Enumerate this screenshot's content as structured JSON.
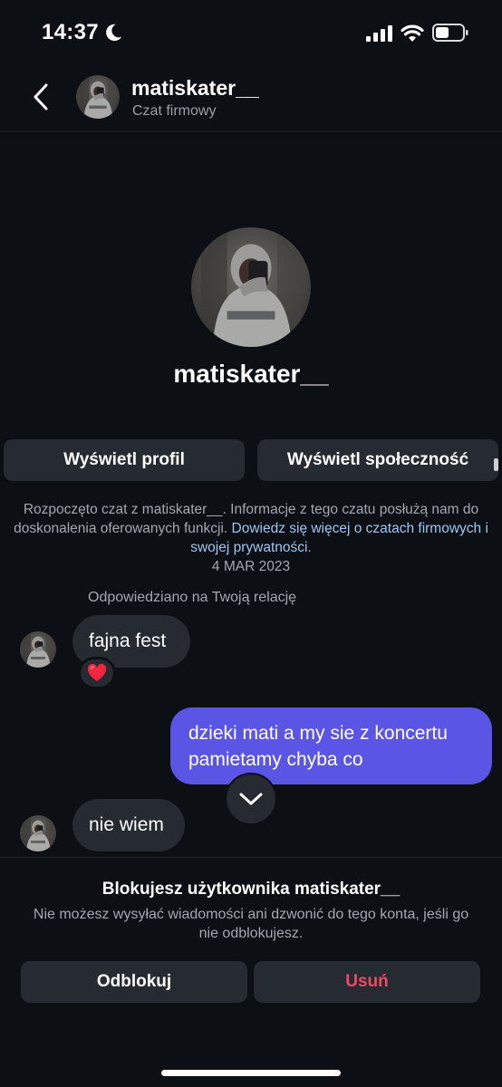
{
  "status_bar": {
    "time": "14:37",
    "icons": [
      "moon-icon",
      "signal-icon",
      "wifi-icon",
      "battery-icon"
    ],
    "battery_level": 0.5
  },
  "header": {
    "username": "matiskater__",
    "subtitle": "Czat firmowy",
    "back_icon": "chevron-left-icon"
  },
  "profile": {
    "username": "matiskater__",
    "view_profile_label": "Wyświetl profil",
    "view_community_label": "Wyświetl społeczność"
  },
  "chat_info": {
    "text": "Rozpoczęto czat z matiskater__. Informacje z tego czatu posłużą nam do doskonalenia oferowanych funkcji. ",
    "link_text": "Dowiedz się więcej o czatach firmowych i swojej prywatności",
    "link_suffix": ".",
    "date": "4 MAR 2023"
  },
  "messages": {
    "reply_note": "Odpowiedziano na Twoją relację",
    "items": [
      {
        "direction": "incoming",
        "text": "fajna fest",
        "reaction": "❤️"
      },
      {
        "direction": "outgoing",
        "text": "dzieki mati a my sie z koncertu pamietamy chyba co"
      },
      {
        "direction": "incoming",
        "text": "nie wiem"
      }
    ]
  },
  "blocked_footer": {
    "title": "Blokujesz użytkownika matiskater__",
    "description": "Nie możesz wysyłać wiadomości ani dzwonić do tego konta, jeśli go nie odblokujesz.",
    "unblock_label": "Odblokuj",
    "delete_label": "Usuń"
  },
  "colors": {
    "background": "#0c0f14",
    "bubble_incoming": "#262a31",
    "bubble_outgoing": "#5b55e6",
    "link": "#9ec6f0",
    "delete": "#ed4a66"
  }
}
